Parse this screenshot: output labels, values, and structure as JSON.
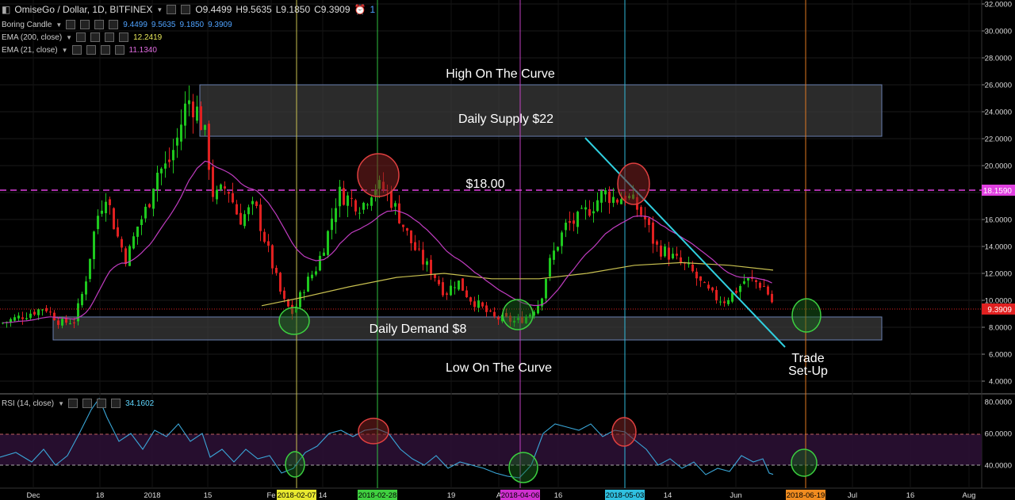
{
  "header": {
    "symbol": "OmiseGo / Dollar, 1D, BITFINEX",
    "open": "O9.4499",
    "high": "H9.5635",
    "low": "L9.1850",
    "close": "C9.3909",
    "alerts_count": "1"
  },
  "indicators": {
    "candle": {
      "label": "Boring Candle",
      "v1": "9.4499",
      "v2": "9.5635",
      "v3": "9.1850",
      "v4": "9.3909"
    },
    "ema200": {
      "label": "EMA (200, close)",
      "value": "12.2419"
    },
    "ema21": {
      "label": "EMA (21, close)",
      "value": "11.1340"
    },
    "rsi": {
      "label": "RSI (14, close)",
      "value": "34.1602"
    }
  },
  "annotations": {
    "high_curve": "High On The Curve",
    "supply": "Daily Supply $22",
    "level18": "$18.00",
    "demand": "Daily Demand $8",
    "low_curve": "Low On The Curve",
    "trade_line1": "Trade",
    "trade_line2": "Set-Up"
  },
  "price_axis": [
    "32.0000",
    "30.0000",
    "28.0000",
    "26.0000",
    "24.0000",
    "22.0000",
    "20.0000",
    "18.0000",
    "16.0000",
    "14.0000",
    "12.0000",
    "10.0000",
    "8.0000",
    "6.0000",
    "4.0000"
  ],
  "price_badges": {
    "level": "18.1590",
    "last": "9.3909"
  },
  "rsi_axis": [
    "80.0000",
    "60.0000",
    "40.0000"
  ],
  "time_axis": [
    "Dec",
    "18",
    "2018",
    "15",
    "Fe",
    "14",
    "19",
    "A",
    "16",
    "14",
    "Jun",
    "Jul",
    "16",
    "Aug"
  ],
  "date_badges": [
    "2018-02-07",
    "2018-02-28",
    "2018-04-06",
    "2018-05-03",
    "2018-06-19"
  ],
  "colors": {
    "background": "#000000",
    "bull": "#1ec81e",
    "bear": "#e02020",
    "ema200": "#c8c050",
    "ema21": "#c03cc0",
    "rsi": "#3aa6d8",
    "level_line": "#e040e0",
    "trendline": "#30d0e0",
    "vline_yellow": "#c8c050",
    "vline_green": "#30c040",
    "vline_magenta": "#c040c0",
    "vline_cyan": "#30b8d8",
    "vline_orange": "#e07820"
  },
  "chart_data": {
    "type": "candlestick",
    "title": "OmiseGo / Dollar, 1D, BITFINEX",
    "y_range": [
      4,
      32
    ],
    "horizontal_level": 18.159,
    "last_price": 9.3909,
    "supply_zone": [
      22,
      26
    ],
    "demand_zone": [
      7.1,
      8.8
    ],
    "rsi_range": [
      30,
      85
    ],
    "rsi_levels": [
      60,
      40
    ],
    "rsi_last": 34.1602,
    "ema200_last": 12.2419,
    "ema21_last": 11.134
  }
}
